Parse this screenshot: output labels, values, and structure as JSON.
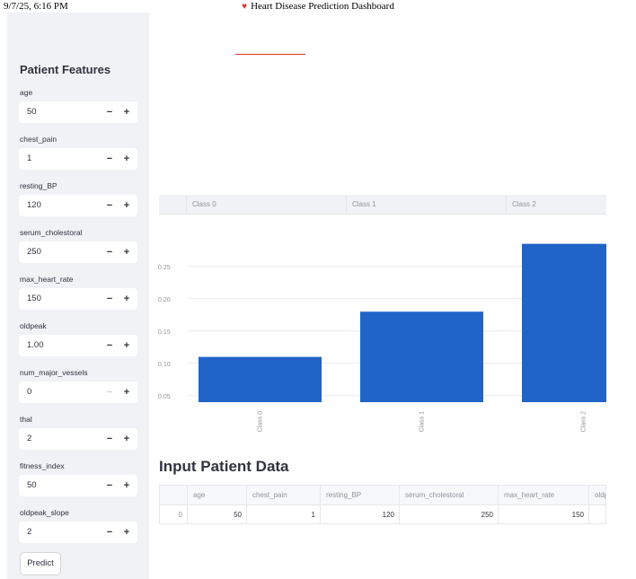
{
  "print_header": {
    "date": "9/7/25, 6:16 PM",
    "title": "Heart Disease Prediction Dashboard"
  },
  "sidebar": {
    "title": "Patient Features",
    "fields": [
      {
        "label": "age",
        "value": "50"
      },
      {
        "label": "chest_pain",
        "value": "1"
      },
      {
        "label": "resting_BP",
        "value": "120"
      },
      {
        "label": "serum_cholestoral",
        "value": "250"
      },
      {
        "label": "max_heart_rate",
        "value": "150"
      },
      {
        "label": "oldpeak",
        "value": "1.00"
      },
      {
        "label": "num_major_vessels",
        "value": "0"
      },
      {
        "label": "thal",
        "value": "2"
      },
      {
        "label": "fitness_index",
        "value": "50"
      },
      {
        "label": "oldpeak_slope",
        "value": "2"
      }
    ],
    "minus_label": "−",
    "plus_label": "+",
    "predict_label": "Predict"
  },
  "probability_table": {
    "headers": [
      "Class 0",
      "Class 1",
      "Class 2"
    ]
  },
  "chart_data": {
    "type": "bar",
    "categories": [
      "Class 0",
      "Class 1",
      "Class 2"
    ],
    "values": [
      0.11,
      0.18,
      0.285
    ],
    "yticks": [
      "0.05",
      "0.10",
      "0.15",
      "0.20",
      "0.25"
    ],
    "ylim": [
      0.04,
      0.29
    ],
    "bar_color": "#2164c7",
    "grid": true
  },
  "input_data": {
    "title": "Input Patient Data",
    "columns": [
      "age",
      "chest_pain",
      "resting_BP",
      "serum_cholestoral",
      "max_heart_rate",
      "oldp"
    ],
    "row": {
      "index": "0",
      "values": [
        "50",
        "1",
        "120",
        "250",
        "150",
        ""
      ]
    }
  }
}
